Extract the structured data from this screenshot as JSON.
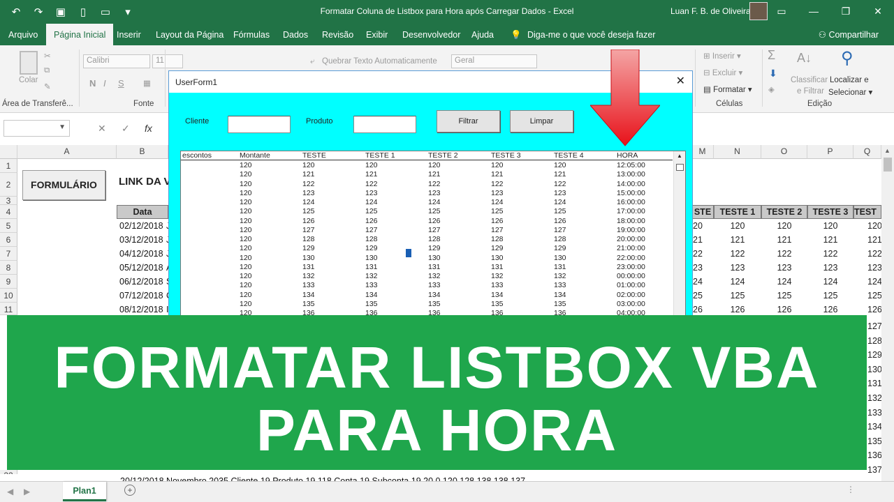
{
  "window": {
    "title": "Formatar Coluna de Listbox para Hora após Carregar Dados  -  Excel",
    "user": "Luan F. B. de Oliveira"
  },
  "menu": {
    "tabs": [
      "Arquivo",
      "Página Inicial",
      "Inserir",
      "Layout da Página",
      "Fórmulas",
      "Dados",
      "Revisão",
      "Exibir",
      "Desenvolvedor",
      "Ajuda"
    ],
    "tell_me": "Diga-me o que você deseja fazer",
    "share": "Compartilhar"
  },
  "ribbon": {
    "paste": "Colar",
    "clipboard_label": "Área de Transferê...",
    "font_name": "Calibri",
    "font_size": "11",
    "font_label": "Fonte",
    "bold": "N",
    "italic": "I",
    "underline": "S",
    "wrap_text": "Quebrar Texto Automaticamente",
    "number_format": "Geral",
    "insert": "Inserir",
    "delete": "Excluir",
    "format": "Formatar",
    "cells_label": "Células",
    "sort": "Classificar",
    "filter": "e Filtrar",
    "find": "Localizar e",
    "select": "Selecionar",
    "editing_label": "Edição"
  },
  "grid": {
    "columns_left": [
      "A",
      "B"
    ],
    "columns_right": [
      "M",
      "N",
      "O",
      "P",
      "Q"
    ],
    "rows": [
      "1",
      "2",
      "3",
      "4",
      "5",
      "6",
      "7",
      "8",
      "9",
      "10",
      "11"
    ],
    "last_row": "22",
    "form_button": "FORMULÁRIO",
    "link_text": "LINK DA V",
    "header_data": "Data",
    "dates": [
      "02/12/2018",
      "03/12/2018",
      "04/12/2018",
      "05/12/2018",
      "06/12/2018",
      "07/12/2018",
      "08/12/2018"
    ],
    "date_suffix": [
      "J",
      "J",
      "J",
      "A",
      "S",
      "C",
      "I"
    ],
    "right_headers": [
      "STE",
      "TESTE 1",
      "TESTE 2",
      "TESTE 3",
      "TEST"
    ],
    "right_values": [
      [
        "20",
        "120",
        "120",
        "120",
        "120"
      ],
      [
        "21",
        "121",
        "121",
        "121",
        "121"
      ],
      [
        "22",
        "122",
        "122",
        "122",
        "122"
      ],
      [
        "23",
        "123",
        "123",
        "123",
        "123"
      ],
      [
        "24",
        "124",
        "124",
        "124",
        "124"
      ],
      [
        "25",
        "125",
        "125",
        "125",
        "125"
      ],
      [
        "26",
        "126",
        "126",
        "126",
        "126"
      ]
    ],
    "right_overflow": [
      "127",
      "128",
      "129",
      "130",
      "131",
      "132",
      "133",
      "134",
      "135",
      "136",
      "137"
    ],
    "bottom_row_text": "20/12/2018 Novembro   2035 Cliente 19   Produto 19   118 Conta 19   Subconta 19   20   0   120   128   138   138   137"
  },
  "userform": {
    "title": "UserForm1",
    "cliente_label": "Cliente",
    "produto_label": "Produto",
    "filtrar": "Filtrar",
    "limpar": "Limpar",
    "list_headers": [
      "escontos",
      "Montante",
      "TESTE",
      "TESTE 1",
      "TESTE 2",
      "TESTE 3",
      "TESTE 4",
      "HORA"
    ],
    "list_rows": [
      [
        "",
        "120",
        "120",
        "120",
        "120",
        "120",
        "120",
        "12:05:00"
      ],
      [
        "",
        "120",
        "121",
        "121",
        "121",
        "121",
        "121",
        "13:00:00"
      ],
      [
        "",
        "120",
        "122",
        "122",
        "122",
        "122",
        "122",
        "14:00:00"
      ],
      [
        "",
        "120",
        "123",
        "123",
        "123",
        "123",
        "123",
        "15:00:00"
      ],
      [
        "",
        "120",
        "124",
        "124",
        "124",
        "124",
        "124",
        "16:00:00"
      ],
      [
        "",
        "120",
        "125",
        "125",
        "125",
        "125",
        "125",
        "17:00:00"
      ],
      [
        "",
        "120",
        "126",
        "126",
        "126",
        "126",
        "126",
        "18:00:00"
      ],
      [
        "",
        "120",
        "127",
        "127",
        "127",
        "127",
        "127",
        "19:00:00"
      ],
      [
        "",
        "120",
        "128",
        "128",
        "128",
        "128",
        "128",
        "20:00:00"
      ],
      [
        "",
        "120",
        "129",
        "129",
        "129",
        "129",
        "129",
        "21:00:00"
      ],
      [
        "",
        "120",
        "130",
        "130",
        "130",
        "130",
        "130",
        "22:00:00"
      ],
      [
        "",
        "120",
        "131",
        "131",
        "131",
        "131",
        "131",
        "23:00:00"
      ],
      [
        "",
        "120",
        "132",
        "132",
        "132",
        "132",
        "132",
        "00:00:00"
      ],
      [
        "",
        "120",
        "133",
        "133",
        "133",
        "133",
        "133",
        "01:00:00"
      ],
      [
        "",
        "120",
        "134",
        "134",
        "134",
        "134",
        "134",
        "02:00:00"
      ],
      [
        "",
        "120",
        "135",
        "135",
        "135",
        "135",
        "135",
        "03:00:00"
      ],
      [
        "",
        "120",
        "136",
        "136",
        "136",
        "136",
        "136",
        "04:00:00"
      ]
    ]
  },
  "banner": {
    "line1": "FORMATAR LISTBOX VBA",
    "line2": "PARA HORA",
    "color": "#1fa64c"
  },
  "sheet": {
    "tab": "Plan1"
  },
  "colors": {
    "excel_green": "#217346",
    "form_bg": "#00ffff",
    "arrow": "#e8121a"
  }
}
